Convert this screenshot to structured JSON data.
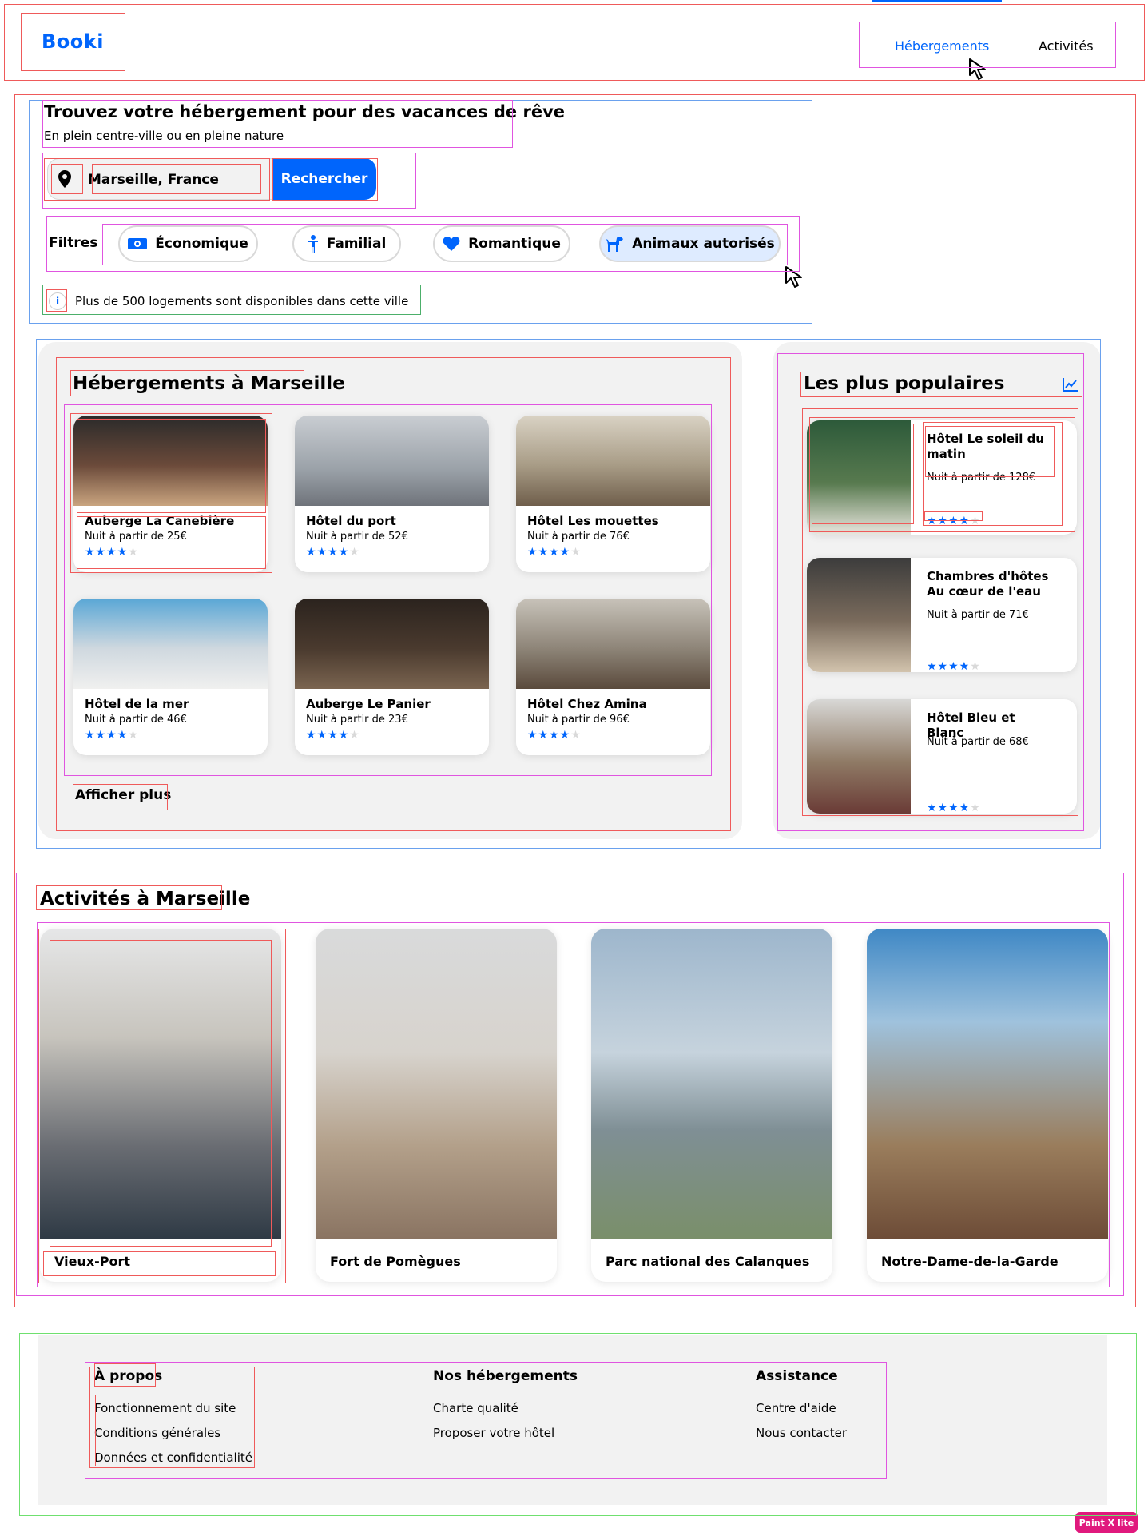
{
  "header": {
    "logo": "Booki",
    "nav": [
      "Hébergements",
      "Activités"
    ]
  },
  "hero": {
    "title": "Trouvez votre hébergement pour des vacances de rêve",
    "subtitle": "En plein centre-ville ou en pleine nature",
    "search_value": "Marseille, France",
    "search_button": "Rechercher",
    "filters_label": "Filtres",
    "filters": [
      "Économique",
      "Familial",
      "Romantique",
      "Animaux autorisés"
    ],
    "info": "Plus de 500 logements sont disponibles dans cette ville"
  },
  "hebergements": {
    "title": "Hébergements à Marseille",
    "cards": [
      {
        "name": "Auberge La Canebière",
        "price": "Nuit à partir de 25€",
        "rating": 4
      },
      {
        "name": "Hôtel du port",
        "price": "Nuit à partir de 52€",
        "rating": 4
      },
      {
        "name": "Hôtel Les mouettes",
        "price": "Nuit à partir de 76€",
        "rating": 4
      },
      {
        "name": "Hôtel de la mer",
        "price": "Nuit à partir de 46€",
        "rating": 4
      },
      {
        "name": "Auberge Le Panier",
        "price": "Nuit à partir de 23€",
        "rating": 4
      },
      {
        "name": "Hôtel Chez Amina",
        "price": "Nuit à partir de 96€",
        "rating": 4
      }
    ],
    "more": "Afficher plus"
  },
  "populaires": {
    "title": "Les plus populaires",
    "icon": "trend-chart-icon",
    "cards": [
      {
        "name": "Hôtel Le soleil du matin",
        "price": "Nuit à partir de 128€",
        "rating": 4
      },
      {
        "name": "Chambres d'hôtes Au cœur de l'eau",
        "price": "Nuit à partir de 71€",
        "rating": 4
      },
      {
        "name": "Hôtel Bleu et Blanc",
        "price": "Nuit à partir de 68€",
        "rating": 4
      }
    ]
  },
  "activites": {
    "title": "Activités à Marseille",
    "cards": [
      {
        "name": "Vieux-Port"
      },
      {
        "name": "Fort de Pomègues"
      },
      {
        "name": "Parc national des Calanques"
      },
      {
        "name": "Notre-Dame-de-la-Garde"
      }
    ]
  },
  "footer": {
    "columns": [
      {
        "title": "À propos",
        "links": [
          "Fonctionnement du site",
          "Conditions générales",
          "Données et confidentialité"
        ]
      },
      {
        "title": "Nos hébergements",
        "links": [
          "Charte qualité",
          "Proposer votre hôtel"
        ]
      },
      {
        "title": "Assistance",
        "links": [
          "Centre d'aide",
          "Nous contacter"
        ]
      }
    ]
  },
  "badge": "Paint X lite",
  "colors": {
    "accent": "#0065fc",
    "panel": "#f2f2f2",
    "selected_filter": "#deebff"
  }
}
